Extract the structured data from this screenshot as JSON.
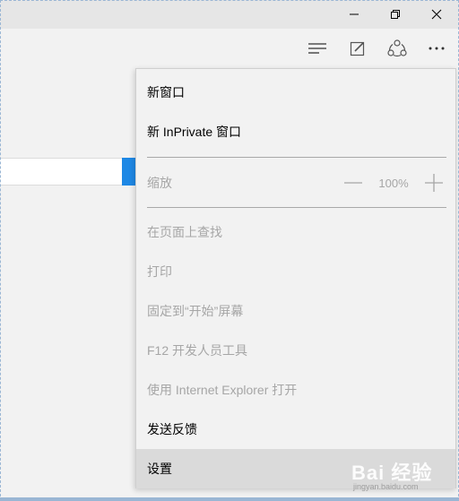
{
  "window": {
    "minimize_icon": "minimize-icon",
    "restore_icon": "restore-icon",
    "close_icon": "close-icon"
  },
  "toolbar": {
    "hub_icon": "hub-icon",
    "note_icon": "web-note-icon",
    "share_icon": "share-icon",
    "more_icon": "more-icon"
  },
  "menu": {
    "items": [
      {
        "label": "新窗口",
        "enabled": true
      },
      {
        "label": "新 InPrivate 窗口",
        "enabled": true
      },
      {
        "label": "缩放",
        "enabled": false
      },
      {
        "label": "在页面上查找",
        "enabled": false
      },
      {
        "label": "打印",
        "enabled": false
      },
      {
        "label": "固定到“开始”屏幕",
        "enabled": false
      },
      {
        "label": "F12 开发人员工具",
        "enabled": false
      },
      {
        "label": "使用 Internet Explorer 打开",
        "enabled": false
      },
      {
        "label": "发送反馈",
        "enabled": true
      },
      {
        "label": "设置",
        "enabled": true,
        "highlighted": true
      }
    ],
    "zoom_value": "100%"
  },
  "watermark": {
    "text": "Bai 经验",
    "sub": "jingyan.baidu.com"
  },
  "colors": {
    "accent": "#1e88e5",
    "disabled_text": "#a6a6a6",
    "menu_bg": "#f2f2f2",
    "highlight": "#dadada"
  }
}
